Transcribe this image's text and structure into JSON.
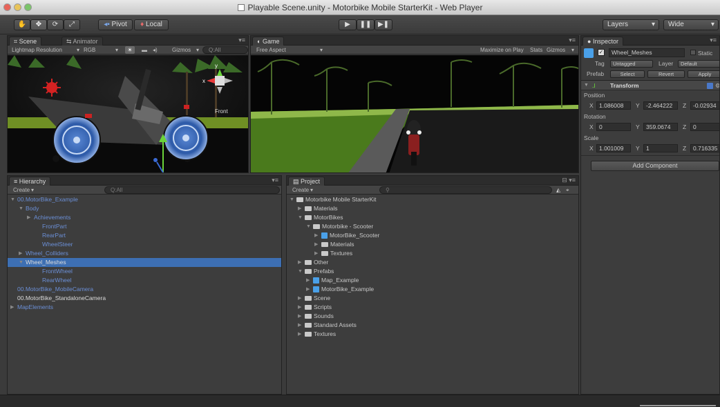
{
  "window": {
    "title": "Playable Scene.unity - Motorbike Mobile StarterKit - Web Player"
  },
  "toolbar": {
    "pivot": "Pivot",
    "local": "Local",
    "layers": "Layers",
    "layout": "Wide"
  },
  "scene": {
    "tab_label": "Scene",
    "tab2_label": "Animator",
    "render_mode": "Lightmap Resolution",
    "color_mode": "RGB",
    "gizmos": "Gizmos",
    "search_placeholder": "Q:All",
    "axis_x": "x",
    "axis_y": "y",
    "axis_label": "Front"
  },
  "game": {
    "tab_label": "Game",
    "aspect": "Free Aspect",
    "maximize": "Maximize on Play",
    "stats": "Stats",
    "gizmos": "Gizmos"
  },
  "inspector": {
    "tab_label": "Inspector",
    "object_name": "Wheel_Meshes",
    "static": "Static",
    "tag_label": "Tag",
    "tag_value": "Untagged",
    "layer_label": "Layer",
    "layer_value": "Default",
    "prefab_label": "Prefab",
    "select": "Select",
    "revert": "Revert",
    "apply": "Apply",
    "component": "Transform",
    "position_label": "Position",
    "rotation_label": "Rotation",
    "scale_label": "Scale",
    "position": {
      "x": "1.086008",
      "y": "-2.464222",
      "z": "-0.02934"
    },
    "rotation": {
      "x": "0",
      "y": "359.0674",
      "z": "0"
    },
    "scale": {
      "x": "1.001009",
      "y": "1",
      "z": "0.716335"
    },
    "add_component": "Add Component"
  },
  "hierarchy": {
    "tab_label": "Hierarchy",
    "create": "Create",
    "search_placeholder": "Q:All",
    "items": [
      {
        "label": "00.MotorBike_Example",
        "depth": 0,
        "arrow": "▼",
        "color": "blue"
      },
      {
        "label": "Body",
        "depth": 1,
        "arrow": "▼",
        "color": "blue"
      },
      {
        "label": "Achievements",
        "depth": 2,
        "arrow": "▶",
        "color": "blue"
      },
      {
        "label": "FrontPart",
        "depth": 3,
        "arrow": "",
        "color": "blue"
      },
      {
        "label": "RearPart",
        "depth": 3,
        "arrow": "",
        "color": "blue"
      },
      {
        "label": "WheelSteer",
        "depth": 3,
        "arrow": "",
        "color": "blue"
      },
      {
        "label": "Wheel_Colliders",
        "depth": 1,
        "arrow": "▶",
        "color": "blue"
      },
      {
        "label": "Wheel_Meshes",
        "depth": 1,
        "arrow": "▼",
        "color": "white",
        "selected": true
      },
      {
        "label": "FrontWheel",
        "depth": 3,
        "arrow": "",
        "color": "blue"
      },
      {
        "label": "RearWheel",
        "depth": 3,
        "arrow": "",
        "color": "blue"
      },
      {
        "label": "00.MotorBike_MobileCamera",
        "depth": 0,
        "arrow": "",
        "color": "blue"
      },
      {
        "label": "00.MotorBike_StandaloneCamera",
        "depth": 0,
        "arrow": "",
        "color": "white"
      },
      {
        "label": "MapElements",
        "depth": 0,
        "arrow": "▶",
        "color": "blue"
      }
    ]
  },
  "project": {
    "tab_label": "Project",
    "create": "Create",
    "items": [
      {
        "label": "Motorbike Mobile StarterKit",
        "depth": 0,
        "arrow": "▼",
        "icon": "folder"
      },
      {
        "label": "Materials",
        "depth": 1,
        "arrow": "▶",
        "icon": "folder"
      },
      {
        "label": "MotorBikes",
        "depth": 1,
        "arrow": "▼",
        "icon": "folder"
      },
      {
        "label": "Motorbike - Scooter",
        "depth": 2,
        "arrow": "▼",
        "icon": "folder"
      },
      {
        "label": "MotorBike_Scooter",
        "depth": 3,
        "arrow": "▶",
        "icon": "cube"
      },
      {
        "label": "Materials",
        "depth": 3,
        "arrow": "▶",
        "icon": "folder"
      },
      {
        "label": "Textures",
        "depth": 3,
        "arrow": "▶",
        "icon": "folder"
      },
      {
        "label": "Other",
        "depth": 1,
        "arrow": "▶",
        "icon": "folder"
      },
      {
        "label": "Prefabs",
        "depth": 1,
        "arrow": "▼",
        "icon": "folder"
      },
      {
        "label": "Map_Example",
        "depth": 2,
        "arrow": "▶",
        "icon": "cube"
      },
      {
        "label": "MotorBike_Example",
        "depth": 2,
        "arrow": "▶",
        "icon": "cube"
      },
      {
        "label": "Scene",
        "depth": 1,
        "arrow": "▶",
        "icon": "folder"
      },
      {
        "label": "Scripts",
        "depth": 1,
        "arrow": "▶",
        "icon": "folder"
      },
      {
        "label": "Sounds",
        "depth": 1,
        "arrow": "▶",
        "icon": "folder"
      },
      {
        "label": "Standard Assets",
        "depth": 1,
        "arrow": "▶",
        "icon": "folder"
      },
      {
        "label": "Textures",
        "depth": 1,
        "arrow": "▶",
        "icon": "folder"
      }
    ]
  }
}
